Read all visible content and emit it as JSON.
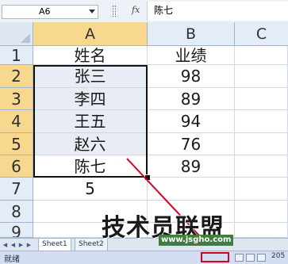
{
  "formula_bar": {
    "name_box": "A6",
    "fx_label": "fx",
    "content": "陈七"
  },
  "columns": [
    "A",
    "B",
    "C"
  ],
  "rows": [
    "1",
    "2",
    "3",
    "4",
    "5",
    "6",
    "7",
    "8",
    "9"
  ],
  "cells": {
    "A1": "姓名",
    "B1": "业绩",
    "A2": "张三",
    "B2": "98",
    "A3": "李四",
    "B3": "89",
    "A4": "王五",
    "B4": "94",
    "A5": "赵六",
    "B5": "76",
    "A6": "陈七",
    "B6": "89",
    "A7": "5"
  },
  "sheet_tabs": [
    "Sheet1",
    "Sheet2"
  ],
  "status": {
    "ready": "就绪",
    "zoom": "205"
  },
  "watermark": {
    "text": "技术员联盟",
    "url": "www.jsgho.com"
  },
  "colors": {
    "selected_header": "#f8d88e",
    "selection_fill": "#e8ecf5",
    "highlight": "#d5001f"
  }
}
